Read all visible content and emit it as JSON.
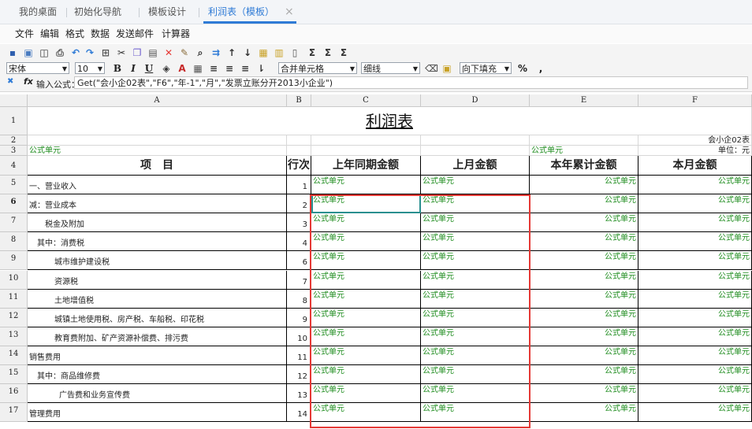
{
  "tabs": [
    "我的桌面",
    "初始化导航",
    "模板设计",
    "利润表（模板）"
  ],
  "tab_close": "×",
  "menu": [
    "文件",
    "编辑",
    "格式",
    "数据",
    "发送邮件",
    "计算器"
  ],
  "toolbar": {
    "font_name": "宋体",
    "font_size": "10",
    "merge": "合并单元格",
    "line": "细线",
    "fill": "向下填充",
    "bold": "B",
    "italic": "I",
    "underline": "U",
    "percent": "%",
    "comma": ","
  },
  "formula_bar": {
    "label": "输入公式：",
    "value": "Get(\"会小企02表\",\"F6\",\"年-1\",\"月\",\"发票立账分开2013小企业\")"
  },
  "columns": [
    "A",
    "B",
    "C",
    "D",
    "E",
    "F"
  ],
  "sheet": {
    "title": "利润表",
    "form_code": "会小企02表",
    "unit": "单位：元",
    "formula_cell": "公式单元",
    "headers": [
      "项　目",
      "行次",
      "上年同期金额",
      "上月金额",
      "本年累计金额",
      "本月金额"
    ],
    "rows": [
      {
        "num": "5",
        "item": "一、营业收入",
        "line": "1"
      },
      {
        "num": "6",
        "item": "减：营业成本",
        "line": "2"
      },
      {
        "num": "7",
        "item": "税金及附加",
        "line": "3"
      },
      {
        "num": "8",
        "item": "其中：消费税",
        "line": "4"
      },
      {
        "num": "9",
        "item": "城市维护建设税",
        "line": "6"
      },
      {
        "num": "10",
        "item": "资源税",
        "line": "7"
      },
      {
        "num": "11",
        "item": "土地增值税",
        "line": "8"
      },
      {
        "num": "12",
        "item": "城镇土地使用税、房产税、车船税、印花税",
        "line": "9"
      },
      {
        "num": "13",
        "item": "教育费附加、矿产资源补偿费、排污费",
        "line": "10"
      },
      {
        "num": "14",
        "item": "销售费用",
        "line": "11"
      },
      {
        "num": "15",
        "item": "其中：商品维修费",
        "line": "12"
      },
      {
        "num": "16",
        "item": "广告费和业务宣传费",
        "line": "13"
      },
      {
        "num": "17",
        "item": "管理费用",
        "line": "14"
      }
    ]
  },
  "colors": {
    "accent": "#2f7bd6",
    "formula_text": "#1e8c1e",
    "highlight": "#e53935"
  }
}
